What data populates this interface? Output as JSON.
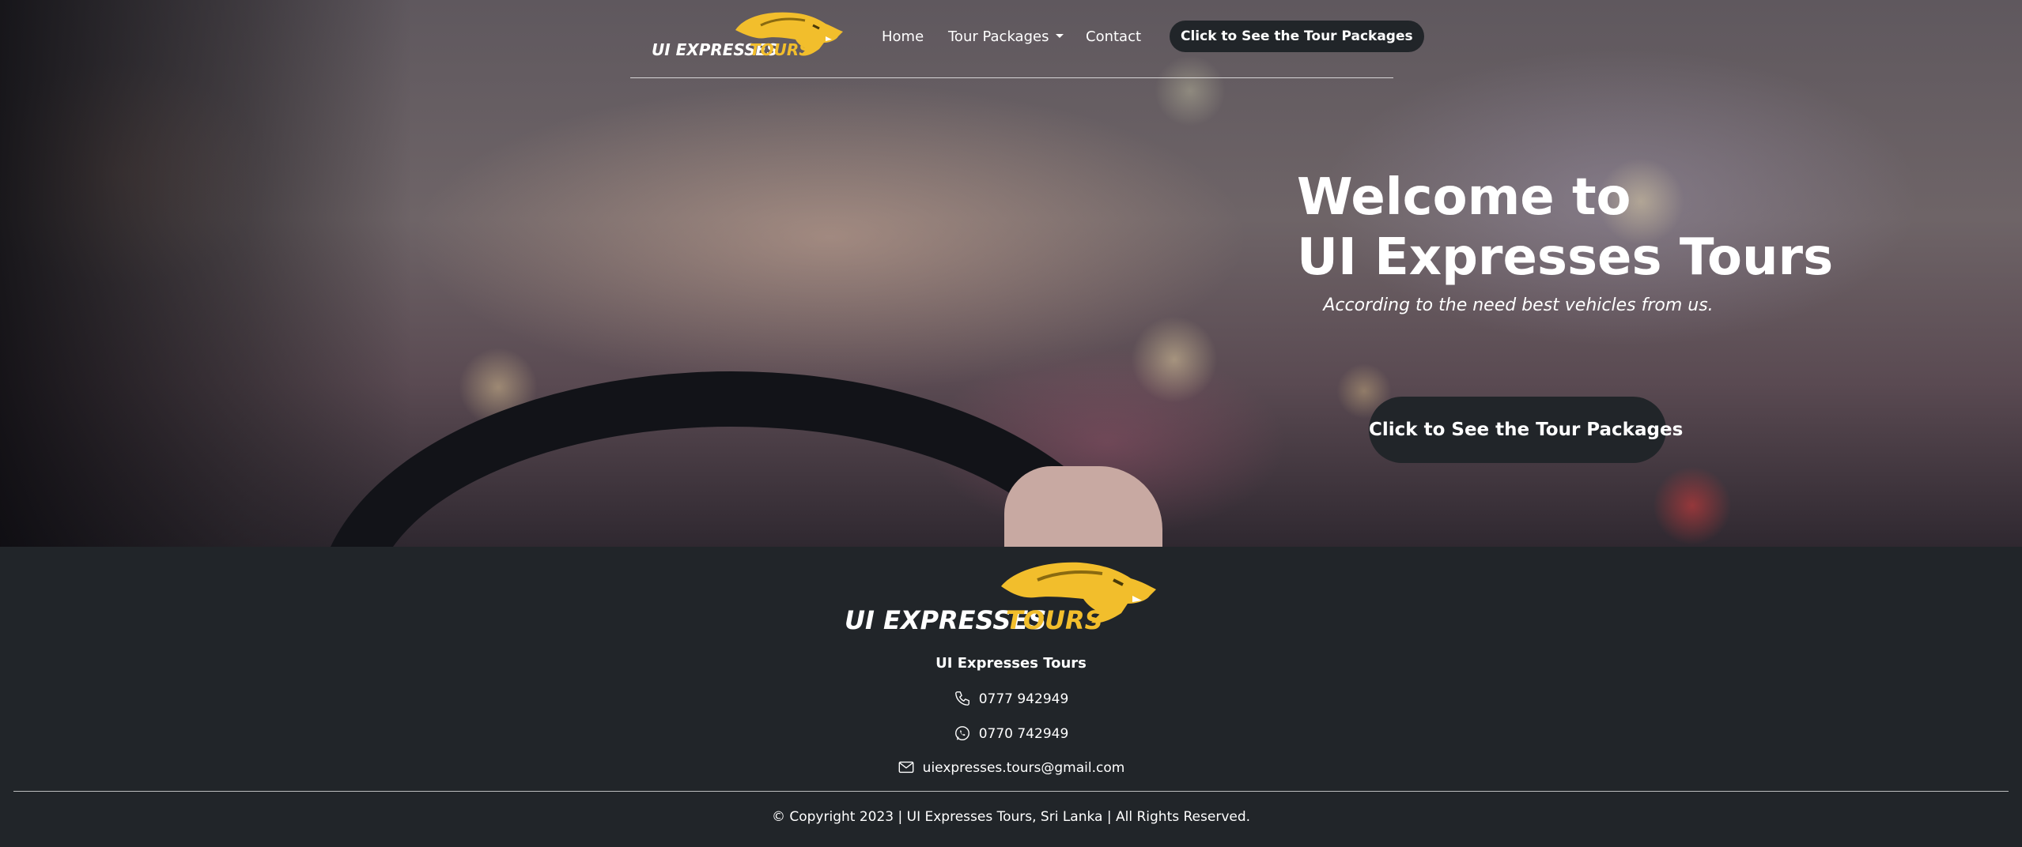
{
  "navbar": {
    "brand": {
      "word1": "UI EXPRESSES",
      "word2": "TOURS"
    },
    "links": [
      {
        "label": "Home"
      },
      {
        "label": "Tour Packages"
      },
      {
        "label": "Contact"
      }
    ],
    "cta_label": "Click to See the Tour Packages"
  },
  "hero": {
    "title_line1": "Welcome to",
    "title_line2": "UI Expresses Tours",
    "subtitle": "According to the need best vehicles from us.",
    "cta_label": "Click to See the Tour Packages"
  },
  "footer": {
    "brand": {
      "word1": "UI EXPRESSES",
      "word2": "TOURS"
    },
    "company_name": "UI Expresses Tours",
    "phone": "0777 942949",
    "whatsapp": "0770 742949",
    "email": "uiexpresses.tours@gmail.com",
    "copyright": "© Copyright 2023 | UI Expresses Tours, Sri Lanka | All Rights Reserved."
  },
  "icons": {
    "phone": "phone-icon",
    "whatsapp": "whatsapp-icon",
    "email": "envelope-icon",
    "dropdown": "caret-down-icon"
  },
  "colors": {
    "brand_yellow": "#f2be2c",
    "dark": "#212529",
    "text": "#ffffff"
  }
}
